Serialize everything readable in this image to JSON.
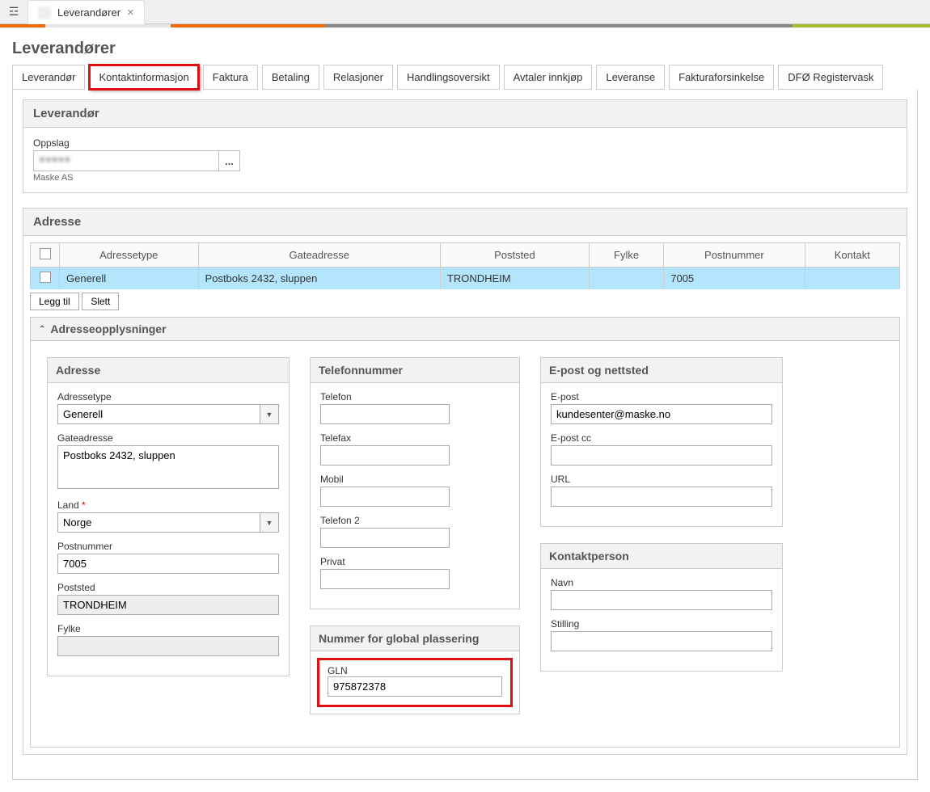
{
  "topTab": {
    "label": "Leverandører"
  },
  "pageTitle": "Leverandører",
  "tabs": [
    "Leverandør",
    "Kontaktinformasjon",
    "Faktura",
    "Betaling",
    "Relasjoner",
    "Handlingsoversikt",
    "Avtaler innkjøp",
    "Leveranse",
    "Fakturaforsinkelse",
    "DFØ Registervask"
  ],
  "activeTabIndex": 1,
  "supplierPanel": {
    "title": "Leverandør",
    "lookupLabel": "Oppslag",
    "lookupValueMasked": "●●●●●",
    "caption": "Maske AS",
    "lookupBtn": "..."
  },
  "addressPanel": {
    "title": "Adresse",
    "columns": [
      "",
      "Adressetype",
      "Gateadresse",
      "Poststed",
      "Fylke",
      "Postnummer",
      "Kontakt"
    ],
    "row": {
      "type": "Generell",
      "street": "Postboks 2432, sluppen",
      "city": "TRONDHEIM",
      "county": "",
      "postcode": "7005",
      "contact": ""
    },
    "addBtn": "Legg til",
    "delBtn": "Slett"
  },
  "details": {
    "header": "Adresseopplysninger",
    "address": {
      "title": "Adresse",
      "typeLabel": "Adressetype",
      "typeValue": "Generell",
      "streetLabel": "Gateadresse",
      "streetValue": "Postboks 2432, sluppen",
      "countryLabel": "Land",
      "countryValue": "Norge",
      "postcodeLabel": "Postnummer",
      "postcodeValue": "7005",
      "cityLabel": "Poststed",
      "cityValue": "TRONDHEIM",
      "countyLabel": "Fylke",
      "countyValue": ""
    },
    "phone": {
      "title": "Telefonnummer",
      "fields": [
        {
          "label": "Telefon",
          "value": ""
        },
        {
          "label": "Telefax",
          "value": ""
        },
        {
          "label": "Mobil",
          "value": ""
        },
        {
          "label": "Telefon 2",
          "value": ""
        },
        {
          "label": "Privat",
          "value": ""
        }
      ]
    },
    "gln": {
      "title": "Nummer for global plassering",
      "label": "GLN",
      "value": "975872378"
    },
    "email": {
      "title": "E-post og nettsted",
      "emailLabel": "E-post",
      "emailValue": "kundesenter@maske.no",
      "ccLabel": "E-post cc",
      "ccValue": "",
      "urlLabel": "URL",
      "urlValue": ""
    },
    "contact": {
      "title": "Kontaktperson",
      "nameLabel": "Navn",
      "nameValue": "",
      "titleLabel": "Stilling",
      "titleValue": ""
    }
  }
}
